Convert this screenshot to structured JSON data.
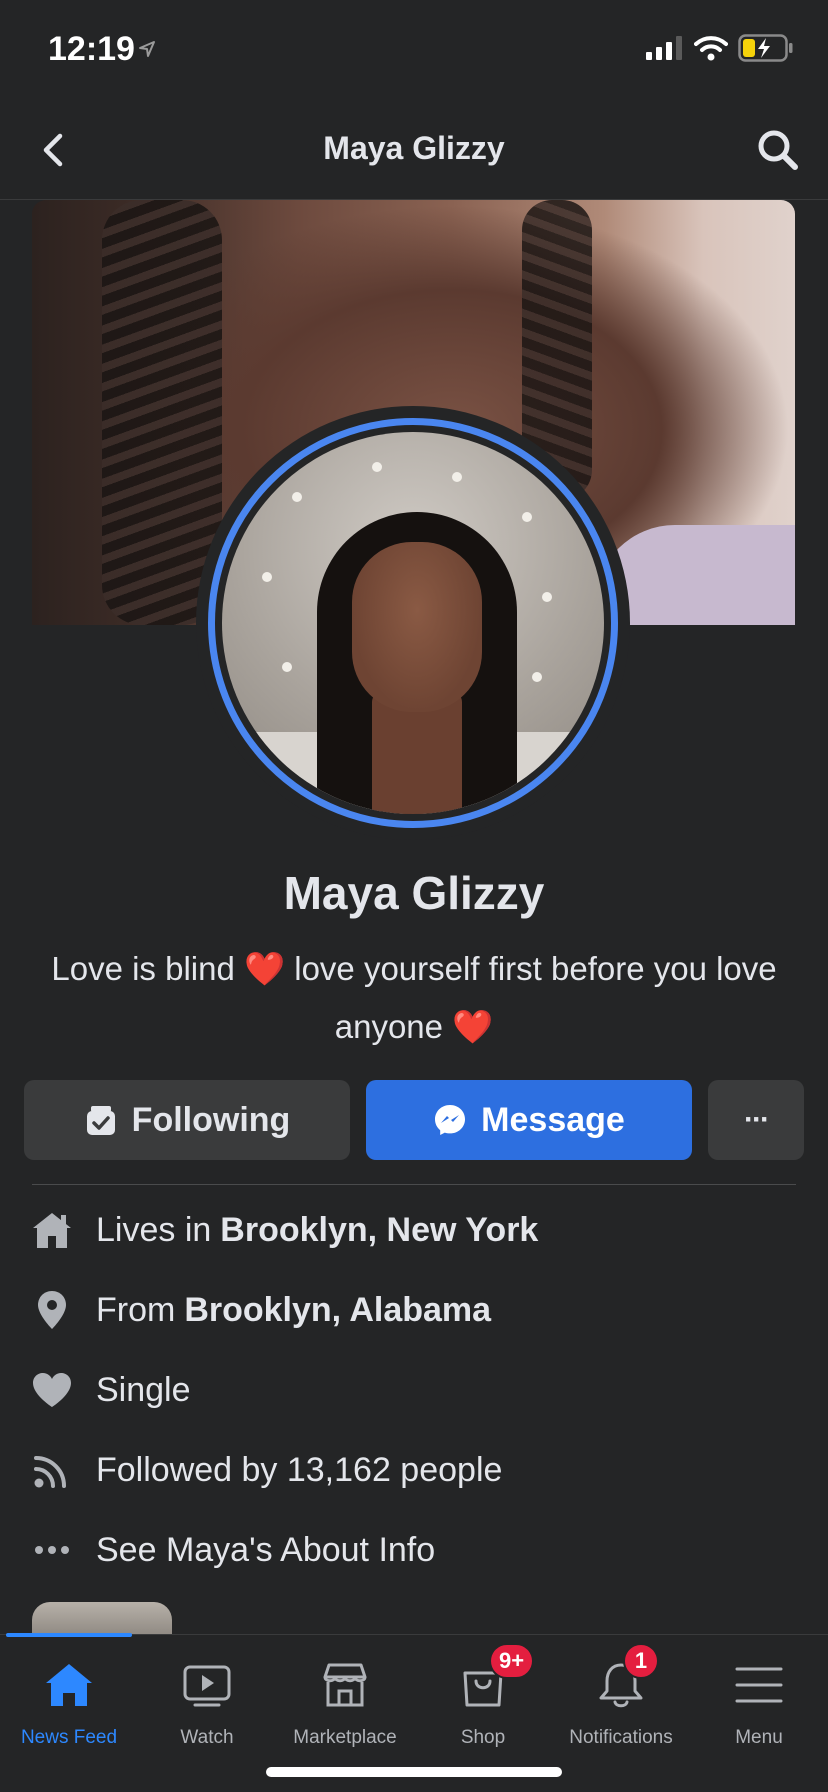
{
  "status_bar": {
    "time": "12:19"
  },
  "nav": {
    "title": "Maya Glizzy"
  },
  "profile": {
    "name": "Maya Glizzy",
    "bio_line1": "Love is blind ❤️ love yourself first before you love",
    "bio_line2": "anyone ❤️"
  },
  "actions": {
    "following_label": "Following",
    "message_label": "Message",
    "more_label": "···"
  },
  "info": {
    "lives_prefix": "Lives in",
    "lives_place": "Brooklyn, New York",
    "from_prefix": "From",
    "from_place": "Brooklyn, Alabama",
    "relationship": "Single",
    "followers": "Followed by 13,162 people",
    "about": "See Maya's About Info"
  },
  "tabs": [
    {
      "label": "News Feed",
      "icon": "home-icon",
      "active": true
    },
    {
      "label": "Watch",
      "icon": "watch-icon"
    },
    {
      "label": "Marketplace",
      "icon": "marketplace-icon"
    },
    {
      "label": "Shop",
      "icon": "shop-icon",
      "badge": "9+"
    },
    {
      "label": "Notifications",
      "icon": "bell-icon",
      "badge": "1"
    },
    {
      "label": "Menu",
      "icon": "menu-icon"
    }
  ],
  "colors": {
    "accent": "#2d88ff",
    "message_button": "#2d6fe0",
    "badge": "#e41e3f",
    "background": "#242526",
    "avatar_ring": "#4a86f0"
  }
}
